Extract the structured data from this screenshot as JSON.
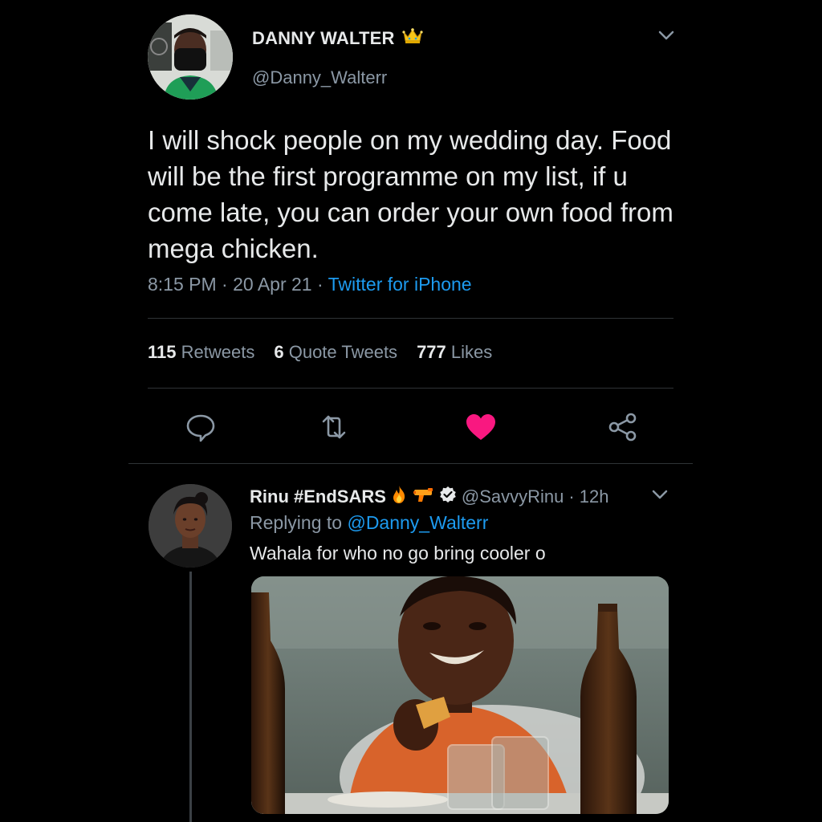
{
  "tweet": {
    "display_name": "DANNY WALTER",
    "name_badge_icon": "crown-icon",
    "handle": "@Danny_Walterr",
    "text": "I will shock people on my wedding day. Food will be the first programme on my list, if u come late, you can order your own food from mega chicken.",
    "time": "8:15 PM",
    "date": "20 Apr 21",
    "separator": "·",
    "source": "Twitter for iPhone",
    "stats": {
      "retweets": {
        "count": "115",
        "label": "Retweets"
      },
      "quote_tweets": {
        "count": "6",
        "label": "Quote Tweets"
      },
      "likes": {
        "count": "777",
        "label": "Likes"
      }
    },
    "actions": [
      "reply-icon",
      "retweet-icon",
      "like-icon",
      "share-icon"
    ],
    "liked_color": "#f91880"
  },
  "reply": {
    "display_name": "Rinu #EndSARS",
    "emojis": [
      "fire-icon",
      "water-gun-icon"
    ],
    "verified": true,
    "handle": "@SavvyRinu",
    "age": "12h",
    "separator": "·",
    "replying_label": "Replying to",
    "replying_to": "@Danny_Walterr",
    "text": "Wahala for who no go bring cooler o",
    "media": "photo of a laughing boy holding food, with beer bottles and glasses on a table"
  },
  "colors": {
    "background": "#000000",
    "text": "#e7e9ea",
    "secondary": "#8b98a5",
    "link": "#1d9bf0",
    "divider": "#2f3336"
  }
}
